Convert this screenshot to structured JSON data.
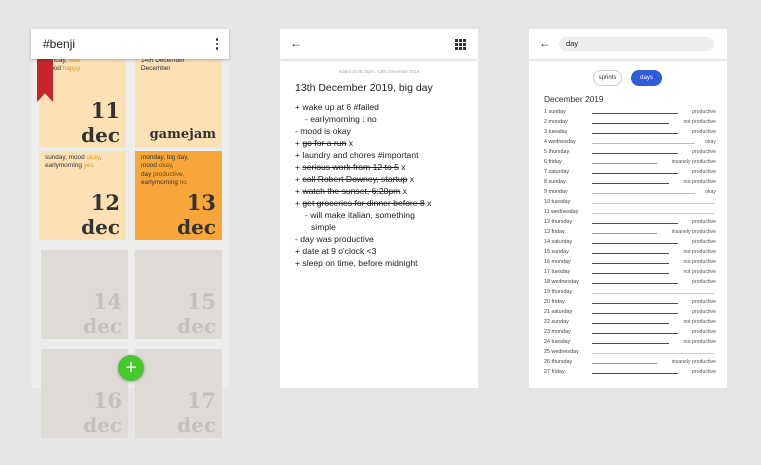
{
  "colors": {
    "productive": "#a32a32",
    "not_productive": "#2a4f8f",
    "insanely_productive": "#6cbf4a",
    "okay": "#d9c43a",
    "empty": "#c9c9c9",
    "accent": "#2f5ddc"
  },
  "calendar": {
    "title": "#benji",
    "fab_icon": "+",
    "cards": [
      {
        "lines": [
          [
            "sunday, ",
            "was"
          ],
          [
            "mood ",
            "happy"
          ]
        ],
        "day": "11",
        "month": "dec"
      },
      {
        "lines": [
          [
            "14th December "
          ],
          [
            "December"
          ]
        ],
        "word": "gamejam"
      },
      {
        "lines": [
          [
            "sunday, mood ",
            "okay",
            ","
          ],
          [
            "earlymorning ",
            "yes"
          ]
        ],
        "day": "12",
        "month": "dec"
      },
      {
        "lines": [
          [
            "monday, big day,"
          ],
          [
            "mood ",
            "okay",
            ","
          ],
          [
            "day ",
            "productive",
            ","
          ],
          [
            "earlymorning ",
            "no"
          ]
        ],
        "day": "13",
        "month": "dec"
      },
      {
        "day": "14",
        "month": "dec"
      },
      {
        "day": "15",
        "month": "dec"
      },
      {
        "day": "16",
        "month": "dec"
      },
      {
        "day": "17",
        "month": "dec"
      }
    ]
  },
  "note": {
    "edited": "edited at 08:15pm, 13th December 2019",
    "title": "13th December 2019, big day",
    "lines": [
      {
        "t": "+ wake up at 6 #failed",
        "s": false,
        "i": 0
      },
      {
        "t": "- earlymorning : no",
        "s": false,
        "i": 1
      },
      {
        "t": "- mood is okay",
        "s": false,
        "i": 0
      },
      {
        "t": "+ ",
        "st": "go for a run",
        "r": " x",
        "i": 0
      },
      {
        "t": "+ laundry and chores #important",
        "s": false,
        "i": 0
      },
      {
        "t": "+ ",
        "st": "serious work from 12 to 5",
        "r": " x",
        "i": 0
      },
      {
        "t": "+ ",
        "st": "call Robert Downey, startup",
        "r": " x",
        "i": 0
      },
      {
        "t": "+ ",
        "st": "watch the sunset, 6:20pm",
        "r": " x",
        "i": 0
      },
      {
        "t": "+ ",
        "st": "get groceries for dinner before 8",
        "r": " x",
        "i": 0
      },
      {
        "t": "- will make italian, something",
        "s": false,
        "i": 1
      },
      {
        "t": "simple",
        "s": false,
        "i": 2
      },
      {
        "t": "- day was productive",
        "s": false,
        "i": 0
      },
      {
        "t": "+ date at 9 o'clock <3",
        "s": false,
        "i": 0
      },
      {
        "t": "+ sleep on time, before midnight",
        "s": false,
        "i": 0
      }
    ]
  },
  "search": {
    "query": "day",
    "chips": {
      "sprints": "sprints",
      "days": "days"
    },
    "month": "December 2019",
    "rows": [
      {
        "d": "1 sunday",
        "v": "productive"
      },
      {
        "d": "2 monday",
        "v": "not productive"
      },
      {
        "d": "3 tuesday",
        "v": "productive"
      },
      {
        "d": "4 wednesday",
        "v": "okay"
      },
      {
        "d": "5 thursday",
        "v": "productive"
      },
      {
        "d": "6 friday",
        "v": "insanely productive"
      },
      {
        "d": "7 saturday",
        "v": "productive"
      },
      {
        "d": "8 sunday",
        "v": "not productive"
      },
      {
        "d": "9 monday",
        "v": "okay"
      },
      {
        "d": "10 tuesday",
        "v": ""
      },
      {
        "d": "11 wednesday",
        "v": ""
      },
      {
        "d": "12 thursday",
        "v": "productive"
      },
      {
        "d": "13 friday",
        "v": "insanely productive"
      },
      {
        "d": "14 saturday",
        "v": "productive"
      },
      {
        "d": "15 sunday",
        "v": "not productive"
      },
      {
        "d": "16 monday",
        "v": "not productive"
      },
      {
        "d": "17 tuesday",
        "v": "not productive"
      },
      {
        "d": "18 wednesday",
        "v": "productive"
      },
      {
        "d": "19 thursday",
        "v": ""
      },
      {
        "d": "20 friday",
        "v": "productive"
      },
      {
        "d": "21 saturday",
        "v": "productive"
      },
      {
        "d": "22 sunday",
        "v": "not productive"
      },
      {
        "d": "23 monday",
        "v": "productive"
      },
      {
        "d": "24 tuesday",
        "v": "not productive"
      },
      {
        "d": "25 wednesday",
        "v": ""
      },
      {
        "d": "26 thursday",
        "v": "insanely productive"
      },
      {
        "d": "27 friday",
        "v": "productive"
      }
    ]
  }
}
